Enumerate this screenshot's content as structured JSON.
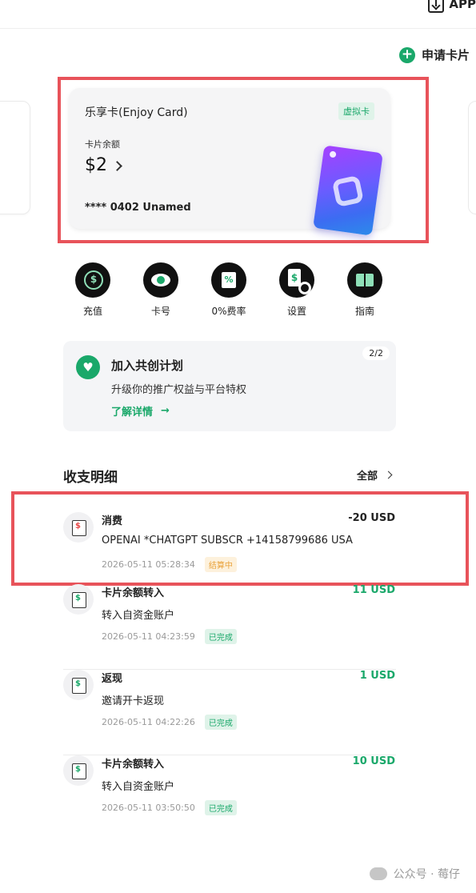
{
  "header": {
    "app_label": "APP",
    "apply_label": "申请卡片"
  },
  "card": {
    "name": "乐享卡(Enjoy Card)",
    "badge": "虚拟卡",
    "balance_label": "卡片余额",
    "balance": "$2",
    "number": "**** 0402  Unamed"
  },
  "actions": [
    {
      "label": "充值",
      "icon": "topup-icon"
    },
    {
      "label": "卡号",
      "icon": "eye-icon"
    },
    {
      "label": "0%费率",
      "icon": "rate-icon"
    },
    {
      "label": "设置",
      "icon": "settings-icon"
    },
    {
      "label": "指南",
      "icon": "guide-icon"
    }
  ],
  "promo": {
    "title": "加入共创计划",
    "subtitle": "升级你的推广权益与平台特权",
    "link": "了解详情",
    "pager": "2/2"
  },
  "transactions": {
    "title": "收支明细",
    "all_label": "全部",
    "items": [
      {
        "title": "消费",
        "amount": "-20 USD",
        "desc": "OPENAI *CHATGPT SUBSCR +14158799686 USA",
        "time": "2026-05-11 05:28:34",
        "status": "结算中"
      },
      {
        "title": "卡片余额转入",
        "amount": "11 USD",
        "desc": "转入自资金账户",
        "time": "2026-05-11 04:23:59",
        "status": "已完成"
      },
      {
        "title": "返现",
        "amount": "1 USD",
        "desc": "邀请开卡返现",
        "time": "2026-05-11 04:22:26",
        "status": "已完成"
      },
      {
        "title": "卡片余额转入",
        "amount": "10 USD",
        "desc": "转入自资金账户",
        "time": "2026-05-11 03:50:50",
        "status": "已完成"
      }
    ]
  },
  "watermark": "公众号 · 莓仔",
  "colors": {
    "accent": "#1aa86a",
    "highlight": "#e8535a",
    "pending": "#e9a23b"
  }
}
